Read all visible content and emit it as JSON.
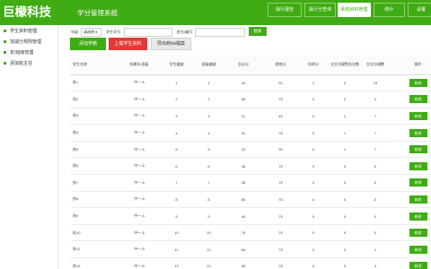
{
  "header": {
    "brand": "巨檬科技",
    "subtitle": "学分管理系统",
    "nav": [
      "操行报告",
      "操行分查询",
      "系统资料管理",
      "统计",
      "设置"
    ],
    "active_nav_index": 2
  },
  "sidebar": {
    "items": [
      "学生资料管理",
      "加减分规则管理",
      "年/班级管理",
      "添加班主任"
    ]
  },
  "filters": {
    "year_label": "年级",
    "year_value": "请选择",
    "student_no_label": "学生学号:",
    "student_no_value": "",
    "name_label": "姓名/编号:",
    "name_value": "",
    "search_label": "搜索"
  },
  "actions": {
    "add_label": "添加学籍",
    "upload_label": "上载学生资料",
    "export_label": "导出到xls檔案"
  },
  "table": {
    "headers": [
      "学生名称",
      "所属年/班级",
      "学生编號",
      "班级编號",
      "总计分",
      "德育分",
      "扣除分",
      "欠交功课警告次数",
      "欠交功课數",
      "操作"
    ],
    "rows": [
      {
        "name": "佚1",
        "class": "中一 A",
        "stu_no": "1",
        "cls_no": "1",
        "total": "24",
        "moral": "92",
        "deduct": "2",
        "warn": "2",
        "owe": "19",
        "action": "修改"
      },
      {
        "name": "佚2",
        "class": "中一 A",
        "stu_no": "2",
        "cls_no": "2",
        "total": "68",
        "moral": "75",
        "deduct": "0",
        "warn": "2",
        "owe": "4",
        "action": "修改"
      },
      {
        "name": "佚3",
        "class": "中一 A",
        "stu_no": "3",
        "cls_no": "3",
        "total": "31",
        "moral": "45",
        "deduct": "0",
        "warn": "1",
        "owe": "7",
        "action": "修改"
      },
      {
        "name": "佚4",
        "class": "中一 A",
        "stu_no": "4",
        "cls_no": "4",
        "total": "51",
        "moral": "75",
        "deduct": "0",
        "warn": "1",
        "owe": "7",
        "action": "修改"
      },
      {
        "name": "佚5",
        "class": "中一 A",
        "stu_no": "5",
        "cls_no": "5",
        "total": "23",
        "moral": "95",
        "deduct": "0",
        "warn": "1",
        "owe": "7",
        "action": "修改"
      },
      {
        "name": "佚6",
        "class": "中一 A",
        "stu_no": "6",
        "cls_no": "6",
        "total": "38",
        "moral": "75",
        "deduct": "0",
        "warn": "0",
        "owe": "0",
        "action": "修改"
      },
      {
        "name": "佚7",
        "class": "中一 A",
        "stu_no": "7",
        "cls_no": "7",
        "total": "38",
        "moral": "75",
        "deduct": "0",
        "warn": "0",
        "owe": "0",
        "action": "修改"
      },
      {
        "name": "佚8",
        "class": "中一 A",
        "stu_no": "8",
        "cls_no": "8",
        "total": "65",
        "moral": "75",
        "deduct": "0",
        "warn": "0",
        "owe": "0",
        "action": "修改"
      },
      {
        "name": "佚9",
        "class": "中一 A",
        "stu_no": "9",
        "cls_no": "9",
        "total": "44",
        "moral": "75",
        "deduct": "0",
        "warn": "0",
        "owe": "0",
        "action": "修改"
      },
      {
        "name": "佚10",
        "class": "中一 A",
        "stu_no": "10",
        "cls_no": "10",
        "total": "75",
        "moral": "75",
        "deduct": "0",
        "warn": "0",
        "owe": "0",
        "action": "修改"
      },
      {
        "name": "佚11",
        "class": "中一 B",
        "stu_no": "11",
        "cls_no": "11",
        "total": "64",
        "moral": "75",
        "deduct": "0",
        "warn": "0",
        "owe": "1",
        "action": "修改"
      },
      {
        "name": "佚12",
        "class": "中一 B",
        "stu_no": "12",
        "cls_no": "12",
        "total": "65",
        "moral": "75",
        "deduct": "0",
        "warn": "0",
        "owe": "0",
        "action": "修改"
      }
    ]
  },
  "colors": {
    "brand_green": "#3fac14",
    "danger_red": "#e53935"
  }
}
